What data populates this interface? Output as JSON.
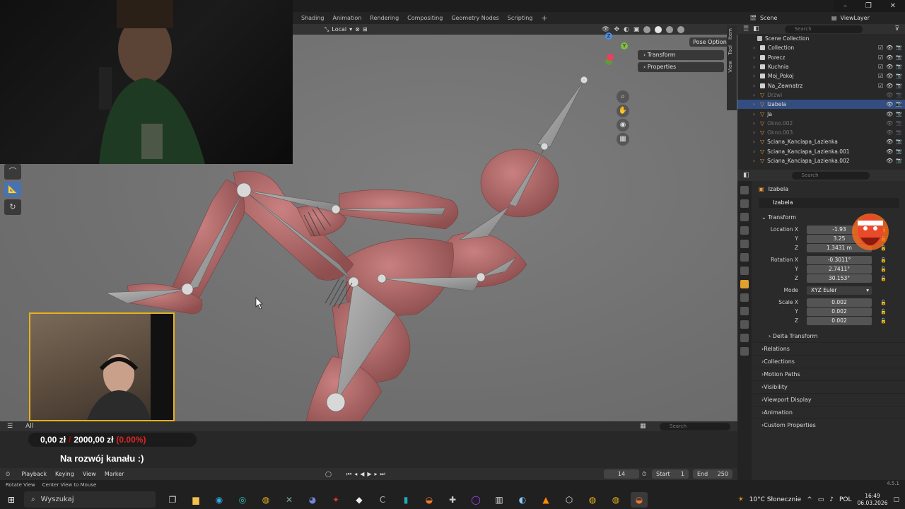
{
  "topbar": {
    "workspace_tabs": [
      "Shading",
      "Animation",
      "Rendering",
      "Compositing",
      "Geometry Nodes",
      "Scripting",
      "+"
    ],
    "scene_label": "Scene",
    "viewlayer_label": "ViewLayer"
  },
  "viewport": {
    "transform_orientation": "Local",
    "pose_options_label": "Pose Options",
    "npanel": {
      "transform_label": "Transform",
      "properties_label": "Properties"
    },
    "side_tabs": [
      "Item",
      "Tool",
      "View"
    ],
    "nav_axes": {
      "z": "Z",
      "y": "Y"
    },
    "footer_all_label": "All",
    "footer_search_placeholder": "Search"
  },
  "stream_overlay": {
    "current_amount": "0,00 zł",
    "separator": "/",
    "goal_amount": "2000,00 zł",
    "goal_percent": "(0.00%)",
    "goal_text": "Na rozwój kanału :)"
  },
  "timeline": {
    "playback_label": "Playback",
    "keying_label": "Keying",
    "view_label": "View",
    "marker_label": "Marker",
    "current_frame": "14",
    "start_label": "Start",
    "start_value": "1",
    "end_label": "End",
    "end_value": "250"
  },
  "status_bar": {
    "rotate_view": "Rotate View",
    "center_view": "Center View to Mouse",
    "version": "4.5.1"
  },
  "outliner": {
    "search_placeholder": "Search",
    "rows": [
      {
        "name": "Scene Collection",
        "indent": 0,
        "type": "scene",
        "dim": false,
        "selected": false
      },
      {
        "name": "Collection",
        "indent": 1,
        "type": "collection",
        "dim": false,
        "selected": false
      },
      {
        "name": "Porecz",
        "indent": 1,
        "type": "collection",
        "dim": false,
        "selected": false
      },
      {
        "name": "Kuchnia",
        "indent": 1,
        "type": "collection",
        "dim": false,
        "selected": false
      },
      {
        "name": "Moj_Pokoj",
        "indent": 1,
        "type": "collection",
        "dim": false,
        "selected": false
      },
      {
        "name": "Na_Zewnatrz",
        "indent": 1,
        "type": "collection",
        "dim": false,
        "selected": false
      },
      {
        "name": "Drzwi",
        "indent": 1,
        "type": "object",
        "dim": true,
        "selected": false
      },
      {
        "name": "Izabela",
        "indent": 1,
        "type": "object",
        "dim": false,
        "selected": true
      },
      {
        "name": "Ja",
        "indent": 1,
        "type": "object",
        "dim": false,
        "selected": false
      },
      {
        "name": "Okno.002",
        "indent": 1,
        "type": "object",
        "dim": true,
        "selected": false
      },
      {
        "name": "Okno.003",
        "indent": 1,
        "type": "object",
        "dim": true,
        "selected": false
      },
      {
        "name": "Sciana_Kanciapa_Lazienka",
        "indent": 1,
        "type": "object",
        "dim": false,
        "selected": false
      },
      {
        "name": "Sciana_Kanciapa_Lazienka.001",
        "indent": 1,
        "type": "object",
        "dim": false,
        "selected": false
      },
      {
        "name": "Sciana_Kanciapa_Lazienka.002",
        "indent": 1,
        "type": "object",
        "dim": false,
        "selected": false
      }
    ]
  },
  "properties": {
    "search_placeholder": "Search",
    "object_label": "Izabela",
    "object_name": "Izabela",
    "transform_title": "Transform",
    "location_label": "Location X",
    "location": [
      "-1.93",
      "3.25",
      "1.3431 m"
    ],
    "rotation_label": "Rotation X",
    "rotation": [
      "-0.3011°",
      "2.7411°",
      "30.153°"
    ],
    "mode_label": "Mode",
    "mode_value": "XYZ Euler",
    "scale_label": "Scale X",
    "scale": [
      "0.002",
      "0.002",
      "0.002"
    ],
    "axis_y": "Y",
    "axis_z": "Z",
    "delta_transform": "Delta Transform",
    "collapsed_panels": [
      "Relations",
      "Collections",
      "Motion Paths",
      "Visibility",
      "Viewport Display",
      "Animation",
      "Custom Properties"
    ]
  },
  "taskbar": {
    "search_label": "Wyszukaj",
    "weather": "10°C Słonecznie",
    "language": "POL",
    "time": "16:49",
    "date": "06.03.2026"
  },
  "colors": {
    "accent": "#4772b3",
    "selected_row": "#334d80",
    "mesh": "#b86b6b",
    "bone": "#9c9c9c",
    "webcam_border": "#e8b21a",
    "goal_percent": "#e02525"
  }
}
